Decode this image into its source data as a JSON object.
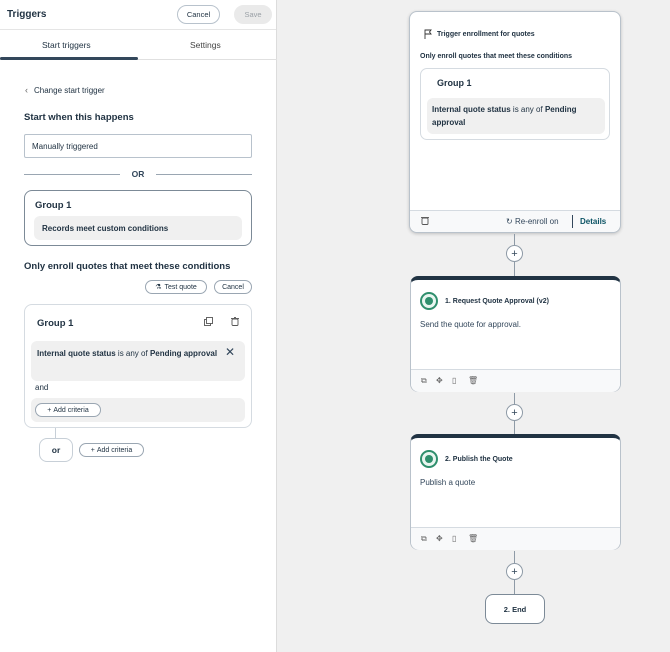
{
  "header": {
    "title": "Triggers",
    "cancel_label": "Cancel",
    "save_label": "Save"
  },
  "tabs": [
    {
      "label": "Start triggers",
      "active": true
    },
    {
      "label": "Settings",
      "active": false
    }
  ],
  "start": {
    "change_label": "Change start trigger",
    "section_title": "Start when this happens",
    "trigger_value": "Manually triggered",
    "or_label": "OR",
    "group_title": "Group 1",
    "group_criteria": "Records meet custom conditions"
  },
  "enroll": {
    "title": "Only enroll quotes that meet these conditions",
    "test_label": "Test quote",
    "cancel_label": "Cancel",
    "group_title": "Group 1",
    "criteria": {
      "property": "Internal quote status",
      "operator": " is any of ",
      "value": "Pending approval"
    },
    "and_label": "and",
    "add_criteria_label": "Add criteria",
    "or_label": "or",
    "add_criteria_label_2": "Add criteria"
  },
  "canvas": {
    "trigger_card": {
      "title": "Trigger enrollment for quotes",
      "subtitle": "Only enroll quotes that meet these conditions",
      "group_title": "Group 1",
      "criteria": {
        "property": "Internal quote status",
        "operator": " is any of ",
        "value": "Pending approval"
      },
      "reenroll_label": "Re-enroll on",
      "details_label": "Details"
    },
    "actions": [
      {
        "title": "1. Request Quote Approval (v2)",
        "description": "Send the quote for approval."
      },
      {
        "title": "2. Publish the Quote",
        "description": "Publish a quote"
      }
    ],
    "end_label": "2. End"
  },
  "colors": {
    "accent_dark": "#213343",
    "success": "#2f8f6d",
    "link": "#0b5364",
    "canvas_bg": "#f0f0f0"
  }
}
